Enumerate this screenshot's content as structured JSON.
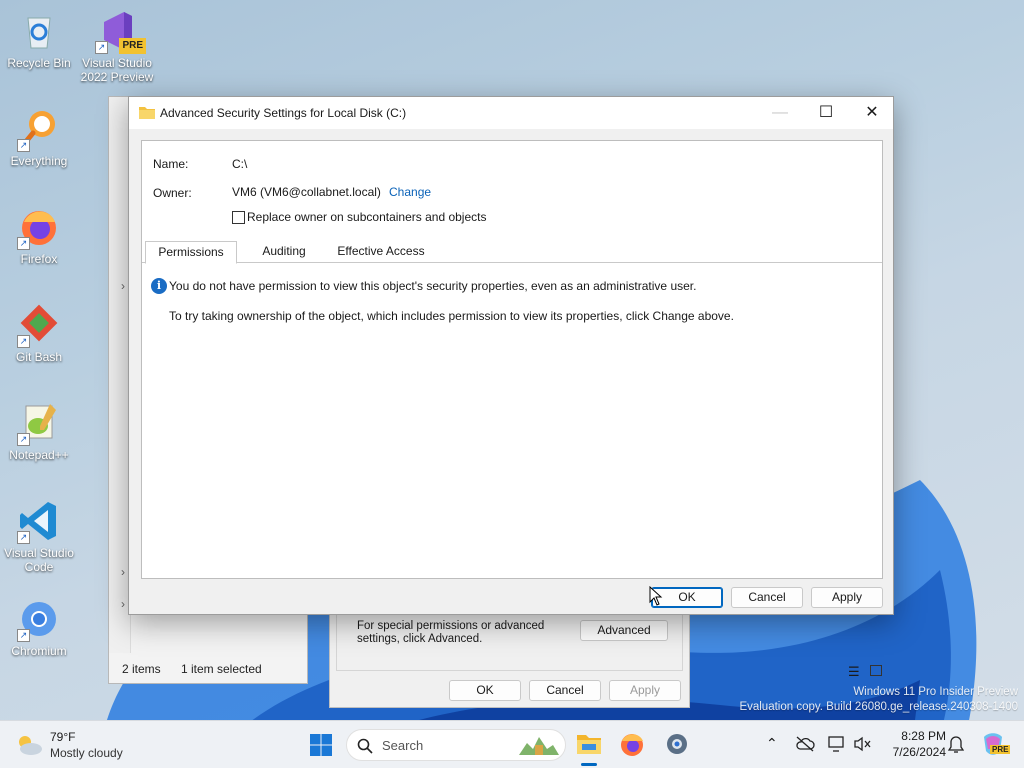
{
  "desktop": {
    "icons": [
      {
        "label": "Recycle Bin",
        "icon": "recycle-bin-icon"
      },
      {
        "label": "Visual Studio 2022 Preview",
        "badge": "PRE",
        "icon": "visual-studio-icon"
      },
      {
        "label": "Everything",
        "icon": "everything-icon"
      },
      {
        "label": "Firefox",
        "icon": "firefox-icon"
      },
      {
        "label": "Git Bash",
        "icon": "git-bash-icon"
      },
      {
        "label": "Notepad++",
        "icon": "notepad-plus-plus-icon"
      },
      {
        "label": "Visual Studio Code",
        "icon": "vscode-icon"
      },
      {
        "label": "Chromium",
        "icon": "chromium-icon"
      }
    ]
  },
  "explorer": {
    "status_items": "2 items",
    "status_selected": "1 item selected"
  },
  "properties_dialog": {
    "description": "For special permissions or advanced settings, click Advanced.",
    "advanced_label": "Advanced",
    "ok_label": "OK",
    "cancel_label": "Cancel",
    "apply_label": "Apply"
  },
  "dialog": {
    "title": "Advanced Security Settings for Local Disk (C:)",
    "name_label": "Name:",
    "name_value": "C:\\",
    "owner_label": "Owner:",
    "owner_value": "VM6 (VM6@collabnet.local)",
    "change_link": "Change",
    "replace_owner_label": "Replace owner on subcontainers and objects",
    "replace_owner_checked": false,
    "tabs": [
      {
        "label": "Permissions",
        "active": true
      },
      {
        "label": "Auditing",
        "active": false
      },
      {
        "label": "Effective Access",
        "active": false
      }
    ],
    "info_message": "You do not have permission to view this object's security properties, even as an administrative user.",
    "hint_message": "To try taking ownership of the object, which includes permission to view its properties, click Change above.",
    "ok_label": "OK",
    "cancel_label": "Cancel",
    "apply_label": "Apply"
  },
  "watermark": {
    "line1": "Windows 11 Pro Insider Preview",
    "line2": "Evaluation copy. Build 26080.ge_release.240308-1400"
  },
  "taskbar": {
    "weather_temp": "79°F",
    "weather_desc": "Mostly cloudy",
    "search_placeholder": "Search",
    "time": "8:28 PM",
    "date": "7/26/2024",
    "copilot_badge": "PRE"
  },
  "colors": {
    "accent": "#0067c0",
    "link": "#0a62b8",
    "info": "#1a6cc4"
  }
}
